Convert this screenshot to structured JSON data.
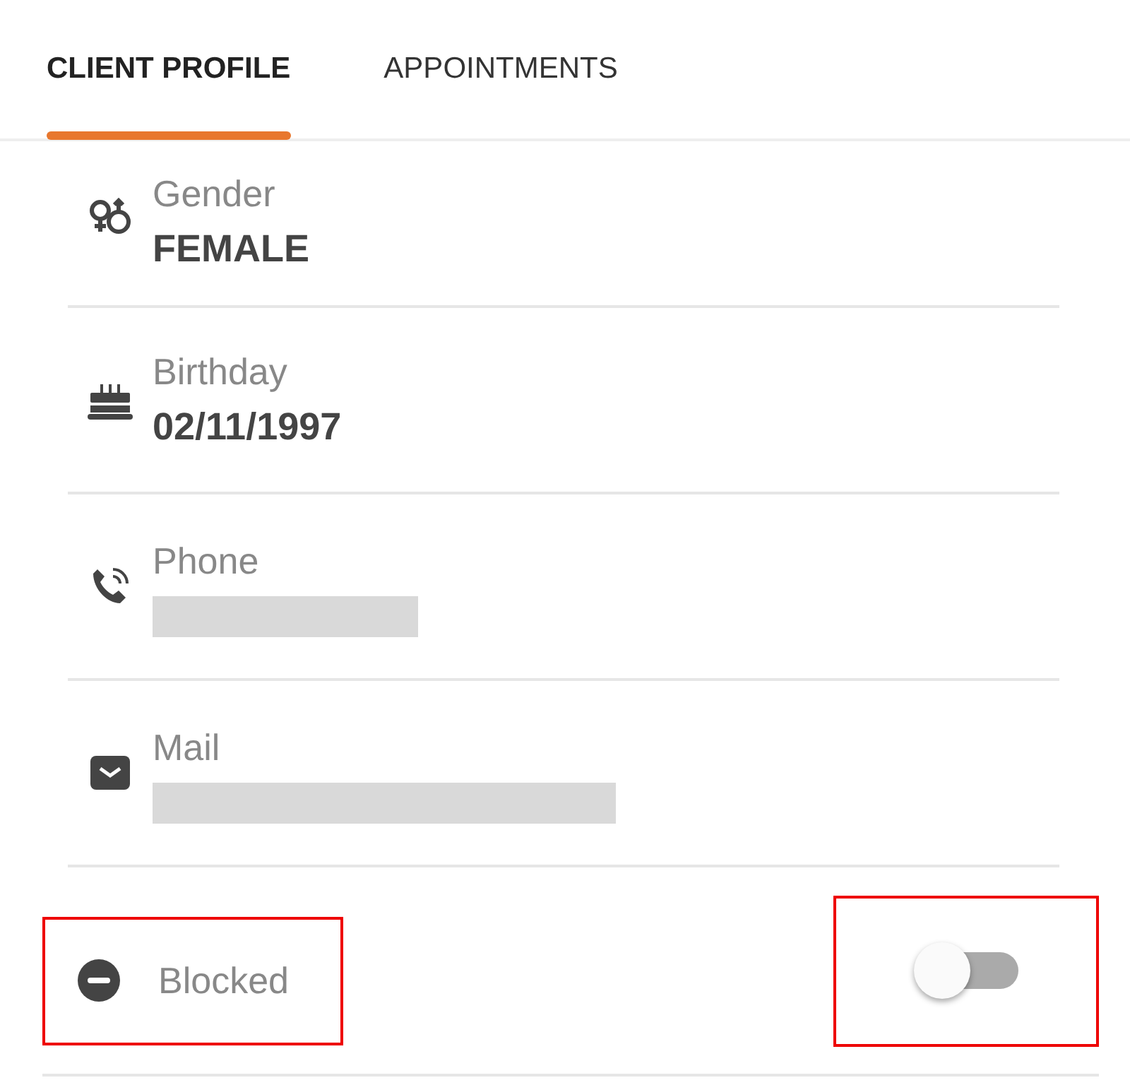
{
  "tabs": [
    {
      "label": "CLIENT PROFILE",
      "selected": true
    },
    {
      "label": "APPOINTMENTS",
      "selected": false
    }
  ],
  "fields": [
    {
      "kind": "gender",
      "label": "Gender",
      "value": "FEMALE"
    },
    {
      "kind": "birthday",
      "label": "Birthday",
      "value": "02/11/1997"
    },
    {
      "kind": "phone",
      "label": "Phone",
      "redacted": true
    },
    {
      "kind": "mail",
      "label": "Mail",
      "redacted": true
    }
  ],
  "blocked": {
    "label": "Blocked",
    "on": false,
    "highlighted": true
  }
}
